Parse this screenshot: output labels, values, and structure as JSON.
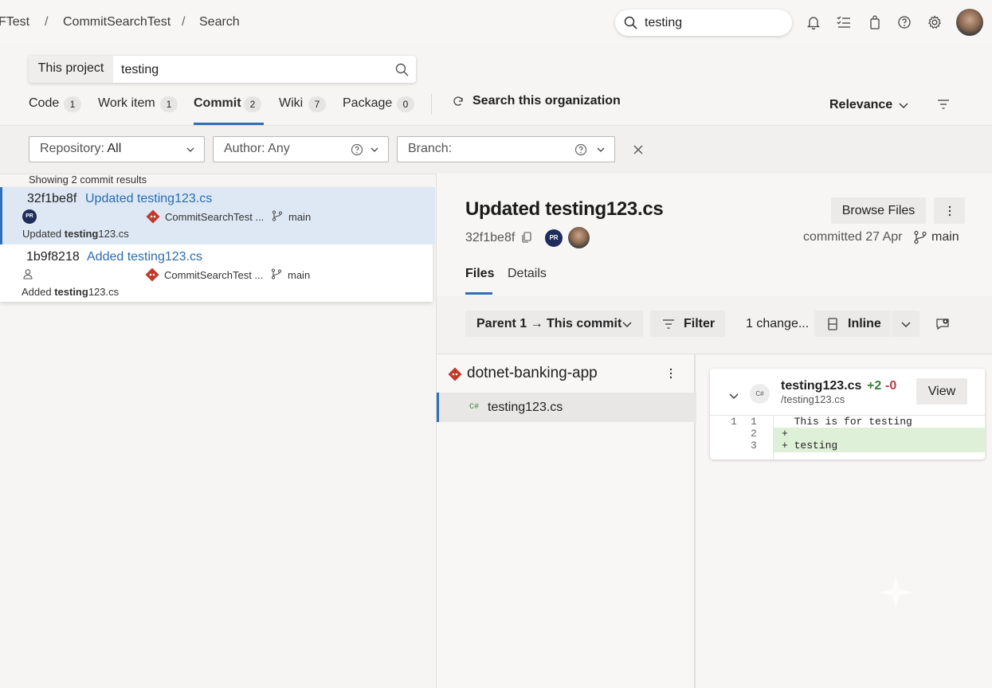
{
  "breadcrumb": {
    "items": [
      "FTest",
      "CommitSearchTest",
      "Search"
    ]
  },
  "top_search": {
    "value": "testing"
  },
  "scope_search": {
    "scope_label": "This project",
    "value": "testing"
  },
  "tabs": [
    {
      "label": "Code",
      "count": "1"
    },
    {
      "label": "Work item",
      "count": "1"
    },
    {
      "label": "Commit",
      "count": "2"
    },
    {
      "label": "Wiki",
      "count": "7"
    },
    {
      "label": "Package",
      "count": "0"
    }
  ],
  "search_org_label": "Search this organization",
  "sort": {
    "label": "Relevance"
  },
  "filters": {
    "repository": {
      "label": "Repository:",
      "value": "All"
    },
    "author": {
      "label": "Author:",
      "value": "Any"
    },
    "branch": {
      "label": "Branch:",
      "value": ""
    }
  },
  "results": {
    "count_text": "Showing 2 commit results",
    "items": [
      {
        "hash": "32f1be8f",
        "title": "Updated testing123.cs",
        "avatar": "PR",
        "repo": "CommitSearchTest ...",
        "branch": "main",
        "desc_prefix": "Updated ",
        "desc_bold": "testing",
        "desc_suffix": "123.cs"
      },
      {
        "hash": "1b9f8218",
        "title": "Added testing123.cs",
        "repo": "CommitSearchTest ...",
        "branch": "main",
        "desc_prefix": "Added ",
        "desc_bold": "testing",
        "desc_suffix": "123.cs"
      }
    ]
  },
  "detail": {
    "title": "Updated testing123.cs",
    "browse_files_label": "Browse Files",
    "hash": "32f1be8f",
    "avatar": "PR",
    "committed_text": "committed 27 Apr",
    "branch": "main",
    "tabs": [
      "Files",
      "Details"
    ],
    "compare_label": "Parent 1 → This commit",
    "filter_label": "Filter",
    "changes_label": "1 change...",
    "view_mode_label": "Inline",
    "repo_name": "dotnet-banking-app",
    "file_type_badge": "C#",
    "file_name": "testing123.cs"
  },
  "diff": {
    "file_name": "testing123.cs",
    "additions": "+2",
    "deletions": "-0",
    "path": "/testing123.cs",
    "view_label": "View",
    "lines": [
      {
        "old": "1",
        "new": "1",
        "text": "  This is for testing",
        "added": false
      },
      {
        "old": "",
        "new": "2",
        "text": "+",
        "added": true
      },
      {
        "old": "",
        "new": "3",
        "text": "+ testing",
        "added": true
      }
    ]
  },
  "colors": {
    "accent": "#2f6fb7",
    "link": "#2b6cb0",
    "added_bg": "#dff0d8",
    "git_red": "#c0392b"
  }
}
